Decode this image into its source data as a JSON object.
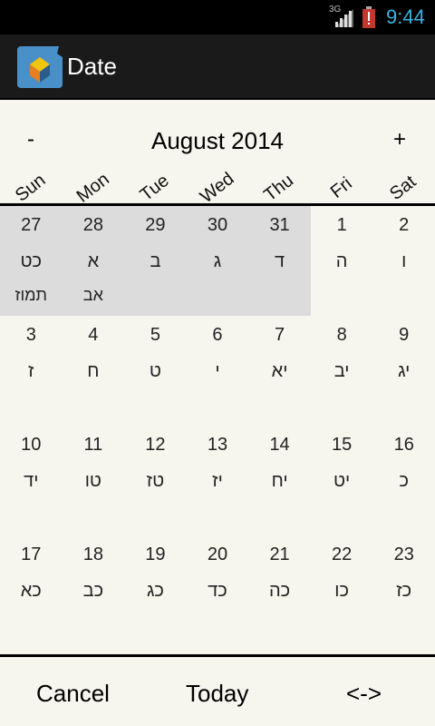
{
  "status": {
    "network": "3G",
    "time": "9:44"
  },
  "app": {
    "title": "Date"
  },
  "calendar": {
    "prev_label": "-",
    "next_label": "+",
    "month_title": "August 2014",
    "weekdays": [
      "Sun",
      "Mon",
      "Tue",
      "Wed",
      "Thu",
      "Fri",
      "Sat"
    ],
    "weeks": [
      [
        {
          "d": "27",
          "h": "כט",
          "m": "תמוז",
          "prev": true
        },
        {
          "d": "28",
          "h": "א",
          "m": "אב",
          "prev": true
        },
        {
          "d": "29",
          "h": "ב",
          "m": "",
          "prev": true
        },
        {
          "d": "30",
          "h": "ג",
          "m": "",
          "prev": true
        },
        {
          "d": "31",
          "h": "ד",
          "m": "",
          "prev": true
        },
        {
          "d": "1",
          "h": "ה",
          "m": "",
          "prev": false
        },
        {
          "d": "2",
          "h": "ו",
          "m": "",
          "prev": false
        }
      ],
      [
        {
          "d": "3",
          "h": "ז",
          "m": "",
          "prev": false
        },
        {
          "d": "4",
          "h": "ח",
          "m": "",
          "prev": false
        },
        {
          "d": "5",
          "h": "ט",
          "m": "",
          "prev": false
        },
        {
          "d": "6",
          "h": "י",
          "m": "",
          "prev": false
        },
        {
          "d": "7",
          "h": "יא",
          "m": "",
          "prev": false
        },
        {
          "d": "8",
          "h": "יב",
          "m": "",
          "prev": false
        },
        {
          "d": "9",
          "h": "יג",
          "m": "",
          "prev": false
        }
      ],
      [
        {
          "d": "10",
          "h": "יד",
          "m": "",
          "prev": false
        },
        {
          "d": "11",
          "h": "טו",
          "m": "",
          "prev": false
        },
        {
          "d": "12",
          "h": "טז",
          "m": "",
          "prev": false
        },
        {
          "d": "13",
          "h": "יז",
          "m": "",
          "prev": false
        },
        {
          "d": "14",
          "h": "יח",
          "m": "",
          "prev": false
        },
        {
          "d": "15",
          "h": "יט",
          "m": "",
          "prev": false
        },
        {
          "d": "16",
          "h": "כ",
          "m": "",
          "prev": false
        }
      ],
      [
        {
          "d": "17",
          "h": "כא",
          "m": "",
          "prev": false
        },
        {
          "d": "18",
          "h": "כב",
          "m": "",
          "prev": false
        },
        {
          "d": "19",
          "h": "כג",
          "m": "",
          "prev": false
        },
        {
          "d": "20",
          "h": "כד",
          "m": "",
          "prev": false
        },
        {
          "d": "21",
          "h": "כה",
          "m": "",
          "prev": false
        },
        {
          "d": "22",
          "h": "כו",
          "m": "",
          "prev": false
        },
        {
          "d": "23",
          "h": "כז",
          "m": "",
          "prev": false
        }
      ]
    ]
  },
  "footer": {
    "cancel": "Cancel",
    "today": "Today",
    "swap": "<->"
  }
}
